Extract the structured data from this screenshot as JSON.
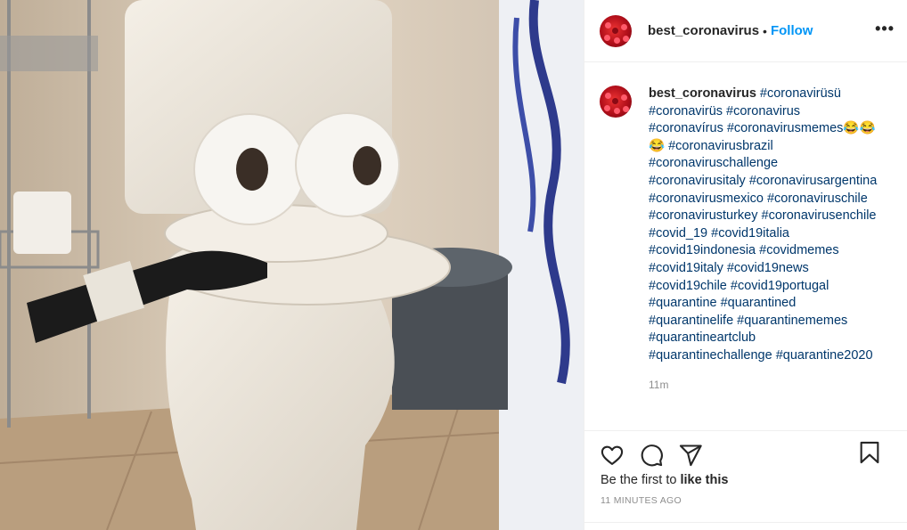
{
  "header": {
    "username": "best_coronavirus",
    "separator": "•",
    "follow_label": "Follow",
    "more_label": "•••"
  },
  "caption": {
    "username": "best_coronavirus",
    "lines": [
      "#coronavirüsü",
      "#coronavirüs #coronavirus",
      "#coronavírus #coronavirusmemes😂😂",
      "😂 #coronavirusbrazil",
      "#coronaviruschallenge",
      "#coronavirusitaly #coronavirusargentina",
      "#coronavirusmexico #coronaviruschile",
      "#coronavirusturkey #coronavirusenchile",
      "#covid_19 #covid19italia",
      "#covid19indonesia #covidmemes",
      "#covid19italy #covid19news",
      "#covid19chile #covid19portugal",
      "#quarantine #quarantined",
      "#quarantinelife #quarantinememes",
      "#quarantineartclub",
      "#quarantinechallenge #quarantine2020"
    ],
    "time": "11m"
  },
  "likes": {
    "prefix": "Be the first to",
    "action": "like this"
  },
  "timestamp": "11 MINUTES AGO",
  "icons": {
    "like": "heart-icon",
    "comment": "comment-icon",
    "share": "share-icon",
    "save": "bookmark-icon"
  },
  "colors": {
    "link": "#0095f6",
    "hashtag": "#00376b",
    "muted": "#8e8e8e"
  }
}
